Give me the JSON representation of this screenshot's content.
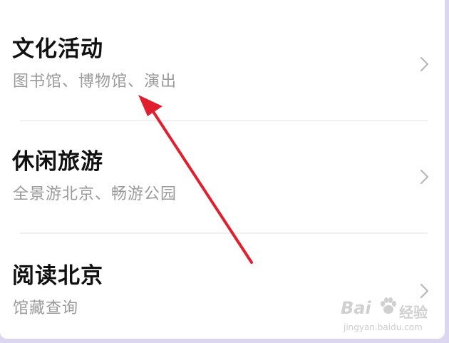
{
  "menu": {
    "items": [
      {
        "title": "文化活动",
        "subtitle": "图书馆、博物馆、演出",
        "chevron": "chevron-right-icon"
      },
      {
        "title": "休闲旅游",
        "subtitle": "全景游北京、畅游公园",
        "chevron": "chevron-right-icon"
      },
      {
        "title": "阅读北京",
        "subtitle": "馆藏查询",
        "chevron": "chevron-right-icon"
      }
    ]
  },
  "annotation": {
    "arrow_color": "#e0202e"
  },
  "watermark": {
    "brand": "Bai",
    "brand_suffix": "经验",
    "url": "jingyan.baidu.com"
  },
  "colors": {
    "background": "#dcd6f0",
    "card": "#ffffff",
    "title": "#111111",
    "subtitle": "#9a9a9a",
    "divider": "#f0f0f2",
    "chevron": "#b5b5b5"
  }
}
